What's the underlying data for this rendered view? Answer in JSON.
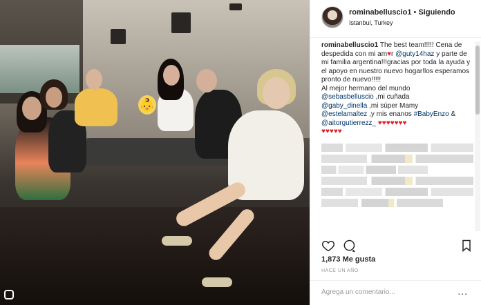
{
  "post": {
    "username": "rominabelluscio1",
    "separator": "•",
    "follow_status": "Siguiendo",
    "location": "Istanbul, Turkey",
    "caption_user": "rominabelluscio1",
    "caption_p1": "The best team!!!!! Cena de despedida con mi am",
    "caption_p2": "r",
    "mention_guty": "@guty14haz",
    "caption_p3": "y parte de mi familia argentina!!!gracias por toda la ayuda y el apoyo en nuestro nuevo hogar!los esperamos pronto de nuevo!!!!!",
    "caption_p4": "Al mejor hermano del mundo",
    "mention_sebas": "@sebasbelluscio",
    "caption_p5": ",mi cuñada",
    "mention_gaby": "@gaby_dinella",
    "caption_p6": ",mi súper Mamy",
    "mention_estela": "@estelamaltez",
    "caption_p7": ",y mis enanos",
    "hashtag_babyenzo": "#BabyEnzo",
    "caption_p8": "&",
    "mention_aitor": "@aitorgutierrezz_",
    "hearts_line1": "♥♥♥♥♥♥♥",
    "hearts_line2": "♥♥♥♥♥",
    "heart_single": "♥",
    "likes": "1,873 Me gusta",
    "date": "HACE UN AÑO",
    "comment_placeholder": "Agrega un comentario...",
    "more_options": "...",
    "emoji": "👶"
  },
  "icons": {
    "like": "heart-outline-icon",
    "comment": "speech-bubble-icon",
    "save": "bookmark-icon"
  },
  "colors": {
    "link": "#003569",
    "heart": "#e0202a"
  }
}
